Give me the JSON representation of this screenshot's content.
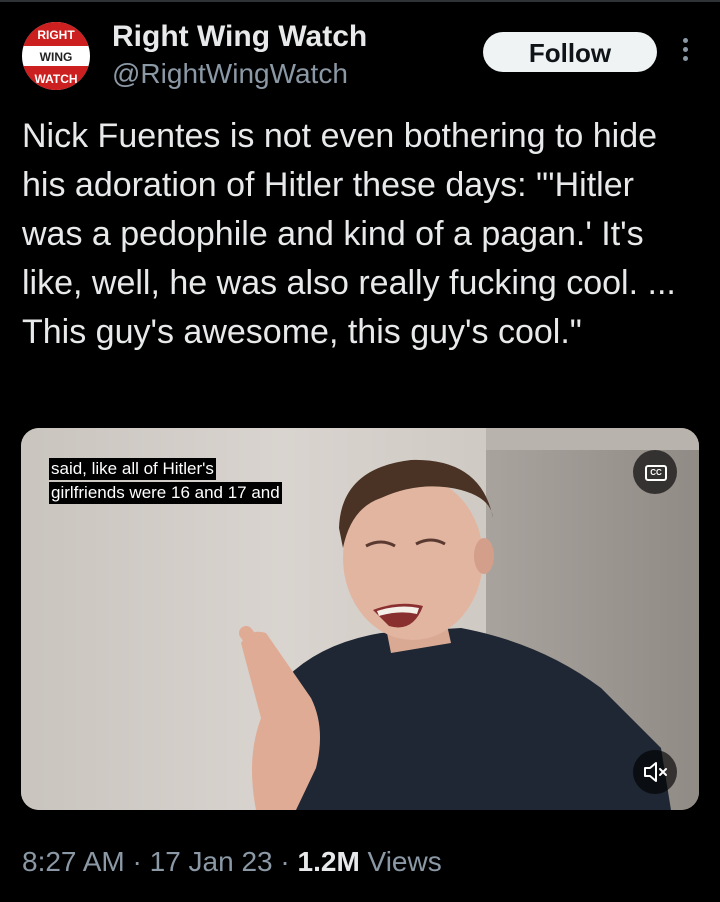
{
  "account": {
    "avatar_lines": [
      "RIGHT",
      "WING",
      "WATCH"
    ],
    "display_name": "Right Wing Watch",
    "handle": "@RightWingWatch"
  },
  "follow_label": "Follow",
  "more_icon": "more-vertical-icon",
  "tweet": {
    "text": "Nick Fuentes is not even bothering to hide his adoration of Hitler these days: \"'Hitler was a pedophile and kind of a pagan.' It's like, well, he was also really fucking cool. ... This guy's awesome, this guy's cool.\""
  },
  "video": {
    "caption_lines": [
      "said, like all of Hitler's",
      "girlfriends were 16 and 17 and"
    ],
    "cc_label": "CC",
    "mute_icon": "volume-muted-icon"
  },
  "meta": {
    "time": "8:27 AM",
    "sep1": " · ",
    "date": "17 Jan 23",
    "sep2": " · ",
    "views_count": "1.2M",
    "views_label": " Views"
  },
  "colors": {
    "background": "#000000",
    "text": "#e7e9ea",
    "secondary": "#8b98a5",
    "follow_bg": "#eff3f4",
    "brand_red": "#cc1f1f"
  }
}
